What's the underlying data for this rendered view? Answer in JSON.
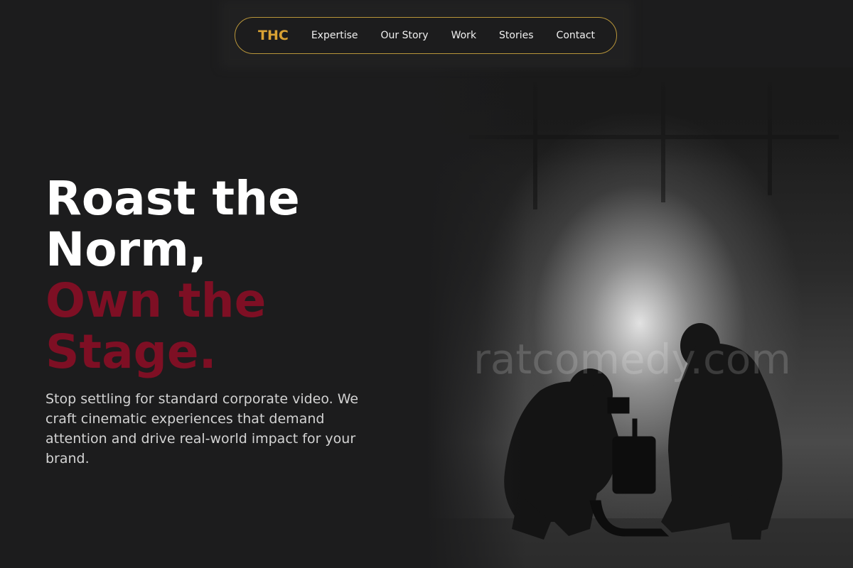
{
  "nav": {
    "logo": "THC",
    "links": [
      {
        "label": "Expertise"
      },
      {
        "label": "Our Story"
      },
      {
        "label": "Work"
      },
      {
        "label": "Stories"
      },
      {
        "label": "Contact"
      }
    ]
  },
  "hero": {
    "headline_line1": "Roast the",
    "headline_line2": "Norm,",
    "headline_line3": "Own the",
    "headline_line4": "Stage.",
    "subtext": "Stop settling for standard corporate video. We craft cinematic experiences that demand attention and drive real-world impact for your brand.",
    "photo_watermark": "ratcomedy.com"
  },
  "colors": {
    "background": "#1c1c1d",
    "logo_gold": "#d9a233",
    "nav_border": "#b8953a",
    "accent_red": "#7e0f24",
    "text_white": "#ffffff",
    "subtext_grey": "#d3d3d3"
  }
}
